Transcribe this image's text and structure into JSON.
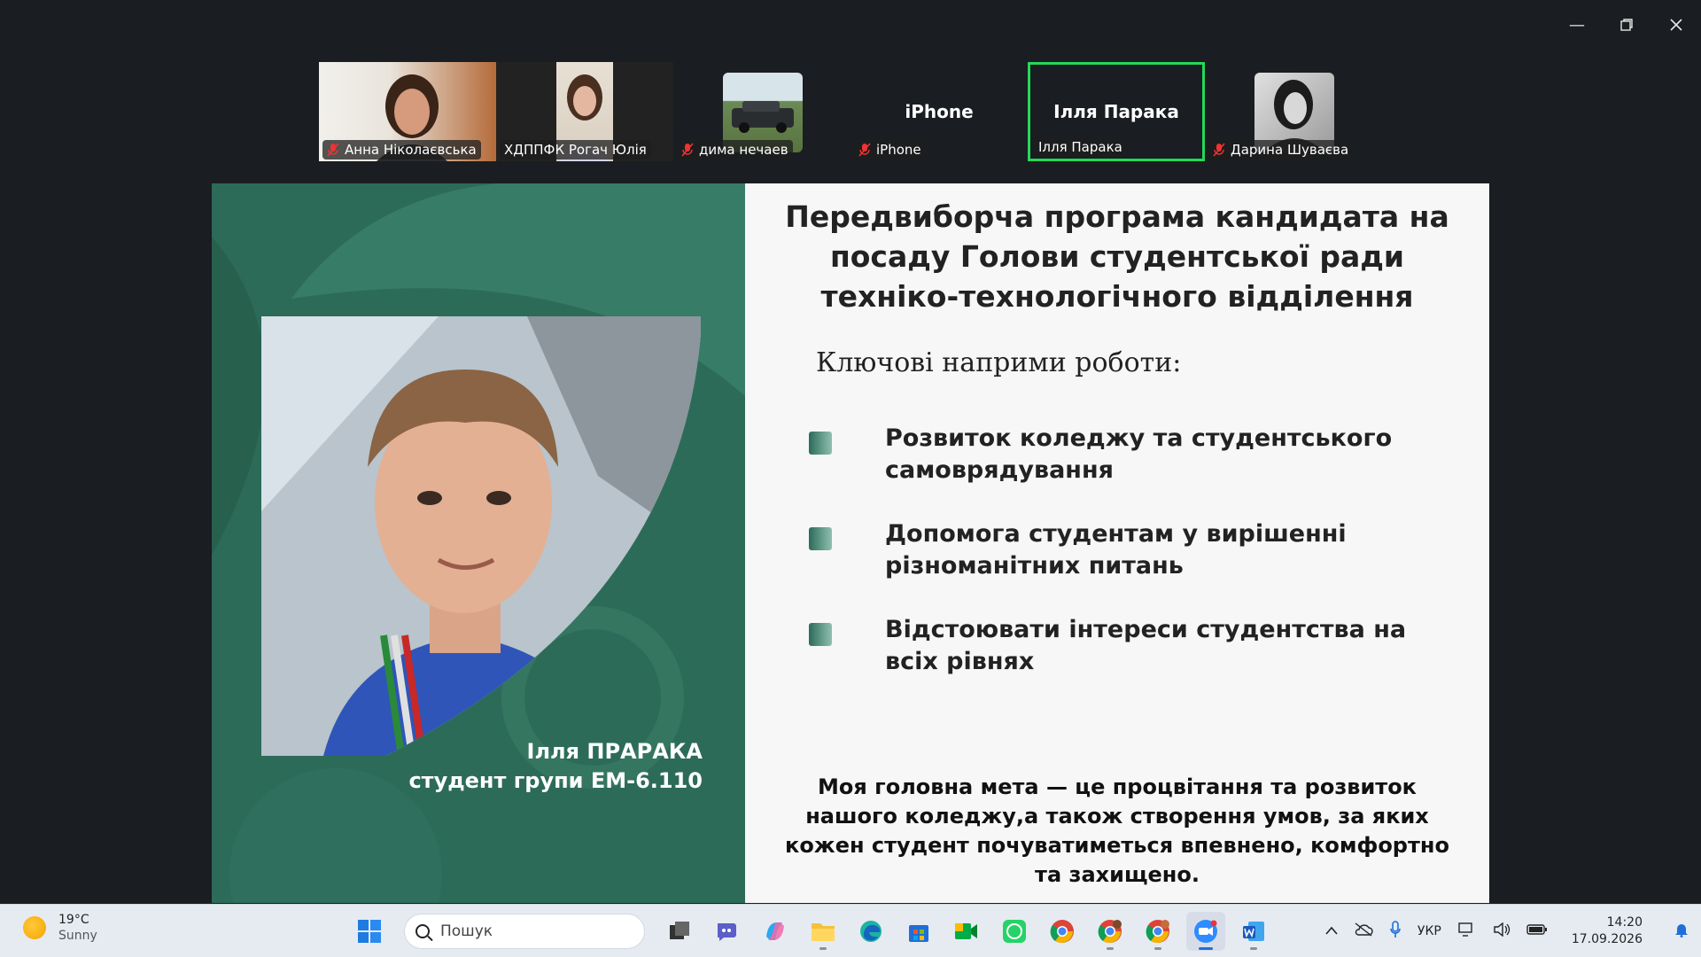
{
  "participants": [
    {
      "name": "Анна Ніколаєвська",
      "muted": true
    },
    {
      "name": "ХДППФК Рогач Юлія",
      "muted": false
    },
    {
      "name": "дима нечаев",
      "muted": true
    },
    {
      "name": "iPhone",
      "display": "iPhone",
      "muted": true
    },
    {
      "name": "Ілля Парака",
      "display": "Ілля Парака",
      "muted": false,
      "active": true
    },
    {
      "name": "Дарина Шуваєва",
      "muted": true
    }
  ],
  "slide": {
    "title": "Передвиборча програма кандидата на посаду Голови студентської ради техніко-технологічного відділення",
    "subhead": "Ключові наприми роботи:",
    "bullets": [
      "Розвиток коледжу та студентського самоврядування",
      "Допомога студентам у вирішенні різноманітних питань",
      "Відстоювати інтереси студентства на всіх рівнях"
    ],
    "goal": "Моя головна мета — це процвітання та розвиток нашого коледжу,а також створення умов, за яких кожен студент почуватиметься впевнено, комфортно та захищено.",
    "caption_name": "Ілля ПРАРАКА",
    "caption_group": "студент групи ЕМ-6.110"
  },
  "taskbar": {
    "temperature": "19°C",
    "condition": "Sunny",
    "search_placeholder": "Пошук",
    "language": "УКР",
    "time": "14:20",
    "date": "17.09.2026"
  },
  "colors": {
    "slide_green": "#2d6b59",
    "active_border": "#23d959",
    "background": "#1a1d21"
  }
}
